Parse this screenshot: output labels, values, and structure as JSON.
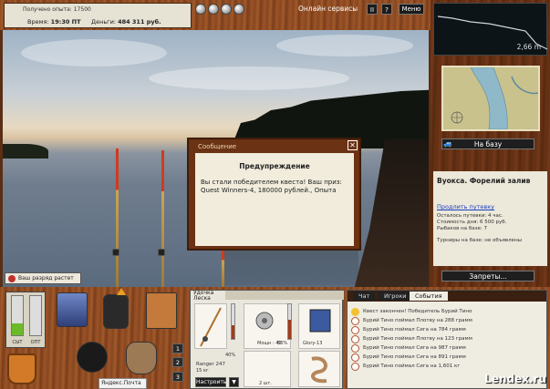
{
  "top_bar": {
    "exp_received": "Получено опыта: 17500",
    "time_label": "Время:",
    "time_value": "19:30 ПТ",
    "money_label": "Деньги:",
    "money_value": "484 311 руб.",
    "online_services": "Онлайн сервисы",
    "pause_label": "II",
    "help_label": "?",
    "menu_label": "Меню"
  },
  "depth": {
    "value": "2,66 m"
  },
  "location": {
    "base_button": "На базу",
    "title": "Вуокса. Форелий залив",
    "extend_link": "Продлить путевку",
    "lines": [
      "Осталось путевки: 4 час.",
      "Стоимость дня: 6 500 руб.",
      "Рыбаков на базе: 7",
      "",
      "Турниры на базе: не объявлены"
    ],
    "bans_button": "Запреты..."
  },
  "notification": {
    "rank_growing": "Ваш разряд растет"
  },
  "dialog": {
    "title": "Сообщение",
    "close": "✕",
    "heading": "Предупреждение",
    "text": "Вы стали победителем квеста! Ваш приз: Quest Winners-4, 180000 рублей., Опыта"
  },
  "gauges": {
    "left_label": "СЫТ",
    "right_label": "ОПТ",
    "left_level": 0.3,
    "right_level": 0.0
  },
  "slots": [
    "1",
    "2",
    "3"
  ],
  "yandex_label": "Яндекс.Почта",
  "rod_panel": {
    "tab_line1": "Удочка",
    "tab_line2": "Леска",
    "rod_name": "Ranger 247",
    "rod_weight": "15 кг",
    "rod_pct": "40%",
    "reel_pct": "56%",
    "reel_label": "Мощн : 40",
    "bait_label": "Glory-13",
    "hook_label": "2 шт.",
    "adjust_button": "Настроить",
    "adjust_dropdown": "▼"
  },
  "chat": {
    "tabs": [
      "Чат",
      "Игроки",
      "События"
    ],
    "active_tab": "События",
    "events": [
      {
        "icon": "star",
        "text": "Квест закончен! Победитель Бурий Тино"
      },
      {
        "icon": "hook",
        "text": "Бурий Тино поймал Плотву на 288 грамм"
      },
      {
        "icon": "hook",
        "text": "Бурий Тино поймал Сига на 784 грамм"
      },
      {
        "icon": "hook",
        "text": "Бурий Тино поймал Плотву на 123 грамм"
      },
      {
        "icon": "hook",
        "text": "Бурий Тино поймал Сига на 987 грамм"
      },
      {
        "icon": "hook",
        "text": "Бурий Тино поймал Сига на 891 грамм"
      },
      {
        "icon": "hook",
        "text": "Бурий Тино поймал Сига на 1,601 кг"
      }
    ]
  },
  "watermark": "Lendex.ru"
}
